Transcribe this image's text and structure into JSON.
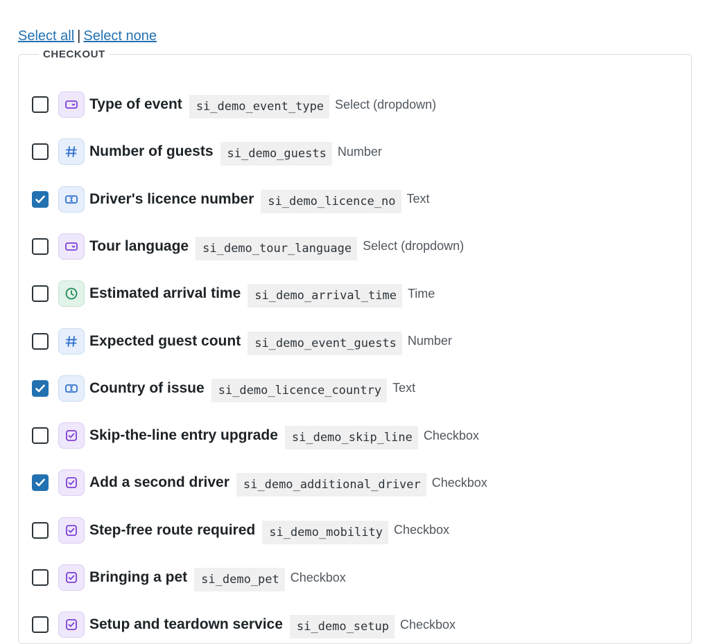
{
  "links": {
    "select_all": "Select all",
    "separator": "|",
    "select_none": "Select none"
  },
  "group": {
    "legend": "CHECKOUT"
  },
  "fields": [
    {
      "label": "Type of event",
      "key": "si_demo_event_type",
      "type": "Select (dropdown)",
      "icon": "dropdown-icon",
      "kind": "select",
      "checked": false
    },
    {
      "label": "Number of guests",
      "key": "si_demo_guests",
      "type": "Number",
      "icon": "hash-icon",
      "kind": "number",
      "checked": false
    },
    {
      "label": "Driver's licence number",
      "key": "si_demo_licence_no",
      "type": "Text",
      "icon": "text-cursor-icon",
      "kind": "text",
      "checked": true
    },
    {
      "label": "Tour language",
      "key": "si_demo_tour_language",
      "type": "Select (dropdown)",
      "icon": "dropdown-icon",
      "kind": "select",
      "checked": false
    },
    {
      "label": "Estimated arrival time",
      "key": "si_demo_arrival_time",
      "type": "Time",
      "icon": "clock-icon",
      "kind": "time",
      "checked": false
    },
    {
      "label": "Expected guest count",
      "key": "si_demo_event_guests",
      "type": "Number",
      "icon": "hash-icon",
      "kind": "number",
      "checked": false
    },
    {
      "label": "Country of issue",
      "key": "si_demo_licence_country",
      "type": "Text",
      "icon": "text-cursor-icon",
      "kind": "text",
      "checked": true
    },
    {
      "label": "Skip-the-line entry upgrade",
      "key": "si_demo_skip_line",
      "type": "Checkbox",
      "icon": "checkbox-icon",
      "kind": "checkbox",
      "checked": false
    },
    {
      "label": "Add a second driver",
      "key": "si_demo_additional_driver",
      "type": "Checkbox",
      "icon": "checkbox-icon",
      "kind": "checkbox",
      "checked": true
    },
    {
      "label": "Step-free route required",
      "key": "si_demo_mobility",
      "type": "Checkbox",
      "icon": "checkbox-icon",
      "kind": "checkbox",
      "checked": false
    },
    {
      "label": "Bringing a pet",
      "key": "si_demo_pet",
      "type": "Checkbox",
      "icon": "checkbox-icon",
      "kind": "checkbox",
      "checked": false
    },
    {
      "label": "Setup and teardown service",
      "key": "si_demo_setup",
      "type": "Checkbox",
      "icon": "checkbox-icon",
      "kind": "checkbox",
      "checked": false
    }
  ],
  "colors": {
    "link": "#2271b1",
    "checked": "#2271b1",
    "select_icon": "#7b3fd6",
    "number_icon": "#2f6fd0",
    "time_icon": "#1f8a55"
  }
}
